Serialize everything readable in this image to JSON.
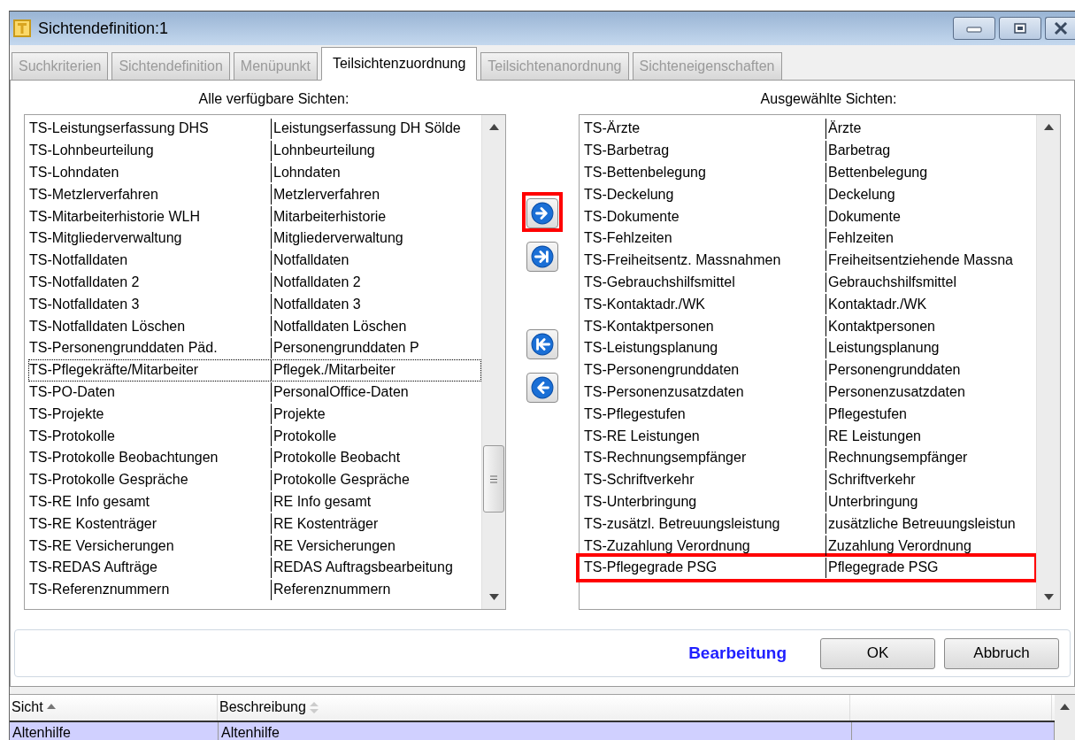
{
  "window": {
    "title": "Sichtendefinition:1"
  },
  "tabs": [
    {
      "label": "Suchkriterien",
      "selected": false
    },
    {
      "label": "Sichtendefinition",
      "selected": false
    },
    {
      "label": "Menüpunkt",
      "selected": false
    },
    {
      "label": "Teilsichtenzuordnung",
      "selected": true
    },
    {
      "label": "Teilsichtenanordnung",
      "selected": false
    },
    {
      "label": "Sichteneigenschaften",
      "selected": false
    }
  ],
  "available": {
    "label": "Alle verfügbare Sichten:",
    "items": [
      {
        "name": "TS-Leistungserfassung DHS",
        "description": "Leistungserfassung DH Sölde",
        "selected": false
      },
      {
        "name": "TS-Lohnbeurteilung",
        "description": "Lohnbeurteilung",
        "selected": false
      },
      {
        "name": "TS-Lohndaten",
        "description": "Lohndaten",
        "selected": false
      },
      {
        "name": "TS-Metzlerverfahren",
        "description": "Metzlerverfahren",
        "selected": false
      },
      {
        "name": "TS-Mitarbeiterhistorie WLH",
        "description": "Mitarbeiterhistorie",
        "selected": false
      },
      {
        "name": "TS-Mitgliederverwaltung",
        "description": "Mitgliederverwaltung",
        "selected": false
      },
      {
        "name": "TS-Notfalldaten",
        "description": "Notfalldaten",
        "selected": false
      },
      {
        "name": "TS-Notfalldaten 2",
        "description": "Notfalldaten 2",
        "selected": false
      },
      {
        "name": "TS-Notfalldaten 3",
        "description": "Notfalldaten 3",
        "selected": false
      },
      {
        "name": "TS-Notfalldaten Löschen",
        "description": "Notfalldaten Löschen",
        "selected": false
      },
      {
        "name": "TS-Personengrunddaten Päd.",
        "description": "Personengrunddaten P",
        "selected": false
      },
      {
        "name": "TS-Pflegekräfte/Mitarbeiter",
        "description": "Pflegek./Mitarbeiter",
        "selected": true
      },
      {
        "name": "TS-PO-Daten",
        "description": "PersonalOffice-Daten",
        "selected": false
      },
      {
        "name": "TS-Projekte",
        "description": "Projekte",
        "selected": false
      },
      {
        "name": "TS-Protokolle",
        "description": "Protokolle",
        "selected": false
      },
      {
        "name": "TS-Protokolle Beobachtungen",
        "description": "Protokolle Beobacht",
        "selected": false
      },
      {
        "name": "TS-Protokolle Gespräche",
        "description": "Protokolle Gespräche",
        "selected": false
      },
      {
        "name": "TS-RE Info gesamt",
        "description": "RE Info gesamt",
        "selected": false
      },
      {
        "name": "TS-RE Kostenträger",
        "description": "RE Kostenträger",
        "selected": false
      },
      {
        "name": "TS-RE Versicherungen",
        "description": "RE Versicherungen",
        "selected": false
      },
      {
        "name": "TS-REDAS Aufträge",
        "description": "REDAS Auftragsbearbeitung",
        "selected": false
      },
      {
        "name": "TS-Referenznummern",
        "description": "Referenznummern",
        "selected": false
      }
    ]
  },
  "move_buttons": [
    {
      "kind": "add",
      "highlighted": true
    },
    {
      "kind": "add_all",
      "highlighted": false
    },
    {
      "kind": "remove_all",
      "highlighted": false
    },
    {
      "kind": "remove",
      "highlighted": false
    }
  ],
  "chosen": {
    "label": "Ausgewählte Sichten:",
    "items": [
      {
        "name": "TS-Ärzte",
        "description": "Ärzte",
        "highlighted": false
      },
      {
        "name": "TS-Barbetrag",
        "description": "Barbetrag",
        "highlighted": false
      },
      {
        "name": "TS-Bettenbelegung",
        "description": "Bettenbelegung",
        "highlighted": false
      },
      {
        "name": "TS-Deckelung",
        "description": "Deckelung",
        "highlighted": false
      },
      {
        "name": "TS-Dokumente",
        "description": "Dokumente",
        "highlighted": false
      },
      {
        "name": "TS-Fehlzeiten",
        "description": "Fehlzeiten",
        "highlighted": false
      },
      {
        "name": "TS-Freiheitsentz. Massnahmen",
        "description": "Freiheitsentziehende Massna",
        "highlighted": false
      },
      {
        "name": "TS-Gebrauchshilfsmittel",
        "description": "Gebrauchshilfsmittel",
        "highlighted": false
      },
      {
        "name": "TS-Kontaktadr./WK",
        "description": "Kontaktadr./WK",
        "highlighted": false
      },
      {
        "name": "TS-Kontaktpersonen",
        "description": "Kontaktpersonen",
        "highlighted": false
      },
      {
        "name": "TS-Leistungsplanung",
        "description": "Leistungsplanung",
        "highlighted": false
      },
      {
        "name": "TS-Personengrunddaten",
        "description": "Personengrunddaten",
        "highlighted": false
      },
      {
        "name": "TS-Personenzusatzdaten",
        "description": "Personenzusatzdaten",
        "highlighted": false
      },
      {
        "name": "TS-Pflegestufen",
        "description": "Pflegestufen",
        "highlighted": false
      },
      {
        "name": "TS-RE Leistungen",
        "description": "RE Leistungen",
        "highlighted": false
      },
      {
        "name": "TS-Rechnungsempfänger",
        "description": "Rechnungsempfänger",
        "highlighted": false
      },
      {
        "name": "TS-Schriftverkehr",
        "description": "Schriftverkehr",
        "highlighted": false
      },
      {
        "name": "TS-Unterbringung",
        "description": "Unterbringung",
        "highlighted": false
      },
      {
        "name": "TS-zusätzl. Betreuungsleistung",
        "description": "zusätzliche Betreuungsleistun",
        "highlighted": false
      },
      {
        "name": "TS-Zuzahlung Verordnung",
        "description": "Zuzahlung Verordnung",
        "highlighted": false
      },
      {
        "name": "TS-Pflegegrade PSG",
        "description": "Pflegegrade PSG",
        "highlighted": true
      }
    ]
  },
  "action_bar": {
    "mode": "Bearbeitung",
    "buttons": [
      "OK",
      "Abbruch"
    ]
  },
  "grid": {
    "columns": [
      {
        "label": "Sicht",
        "sorted": true
      },
      {
        "label": "Beschreibung",
        "sorted": false
      }
    ],
    "rows": [
      {
        "cells": [
          "Altenhilfe",
          "Altenhilfe"
        ],
        "selected": true
      }
    ]
  }
}
